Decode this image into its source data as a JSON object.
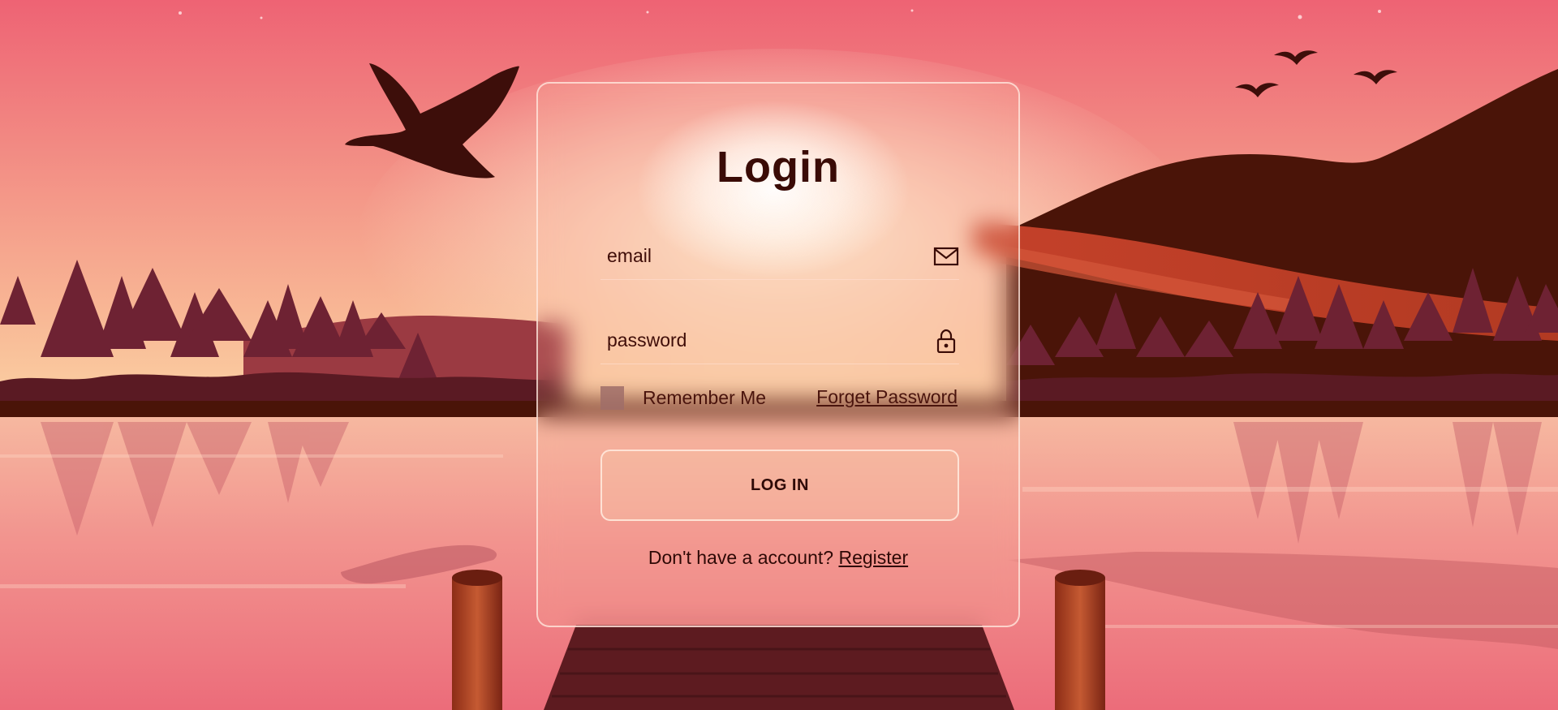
{
  "login": {
    "title": "Login",
    "email_placeholder": "email",
    "password_placeholder": "password",
    "remember_label": "Remember Me",
    "forgot_label": "Forget Password",
    "submit_label": "LOG IN",
    "register_prompt": "Don't have a account?",
    "register_label": "Register"
  },
  "icons": {
    "email": "envelope-icon",
    "password": "lock-icon"
  },
  "colors": {
    "text_dark": "#3a0b06",
    "sky_top": "#ef6a78",
    "sky_horizon": "#f9c49c",
    "mountain": "#4a1408",
    "trees": "#6e2233"
  }
}
